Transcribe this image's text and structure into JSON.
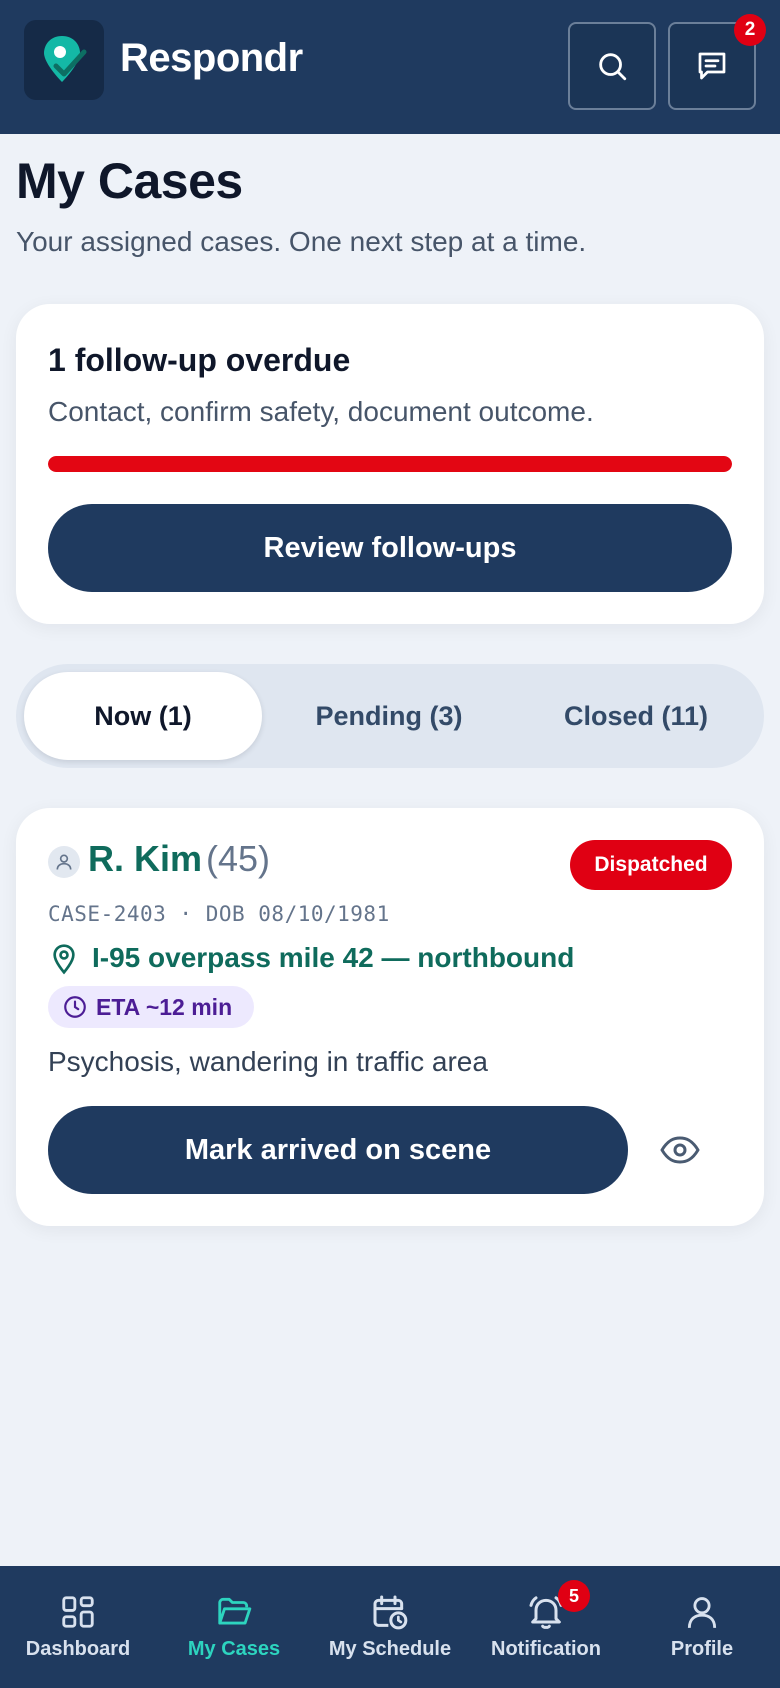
{
  "header": {
    "app_name": "Respondr",
    "messages_badge": "2"
  },
  "page": {
    "title": "My Cases",
    "subtitle": "Your assigned cases. One next step at a time."
  },
  "overdue": {
    "title": "1 follow-up overdue",
    "description": "Contact, confirm safety, document outcome.",
    "progress": 1.0,
    "button_label": "Review follow-ups"
  },
  "tabs": [
    {
      "label": "Now (1)",
      "active": true
    },
    {
      "label": "Pending (3)",
      "active": false
    },
    {
      "label": "Closed (11)",
      "active": false
    }
  ],
  "case": {
    "name": "R. Kim",
    "age": "(45)",
    "status": "Dispatched",
    "meta": "CASE-2403 · DOB 08/10/1981",
    "location": "I-95 overpass mile 42 — northbound",
    "eta": "ETA ~12 min",
    "description": "Psychosis, wandering in traffic area",
    "action_label": "Mark arrived on scene"
  },
  "bottom_nav": [
    {
      "label": "Dashboard",
      "icon": "dashboard-icon",
      "active": false
    },
    {
      "label": "My Cases",
      "icon": "folder-icon",
      "active": true
    },
    {
      "label": "My Schedule",
      "icon": "calendar-clock-icon",
      "active": false
    },
    {
      "label": "Notification",
      "icon": "bell-icon",
      "active": false,
      "badge": "5"
    },
    {
      "label": "Profile",
      "icon": "user-icon",
      "active": false
    }
  ],
  "colors": {
    "brand_navy": "#1f3a5f",
    "accent_teal": "#0f6b5c",
    "alert_red": "#e00013",
    "eta_purple": "#4c1d95"
  }
}
